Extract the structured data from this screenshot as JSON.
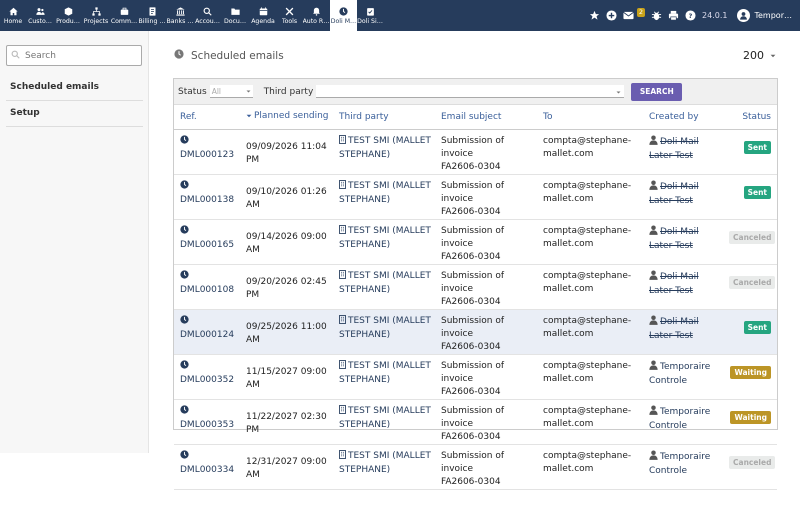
{
  "menu": [
    {
      "label": "Home",
      "icon": "home-icon"
    },
    {
      "label": "Custo…",
      "icon": "users-icon"
    },
    {
      "label": "Produ…",
      "icon": "cube-icon"
    },
    {
      "label": "Projects",
      "icon": "sitemap-icon"
    },
    {
      "label": "Comm…",
      "icon": "suitcase-icon"
    },
    {
      "label": "Billing …",
      "icon": "invoice-icon"
    },
    {
      "label": "Banks …",
      "icon": "bank-icon"
    },
    {
      "label": "Accou…",
      "icon": "search-dollar-icon"
    },
    {
      "label": "Docu…",
      "icon": "folder-icon"
    },
    {
      "label": "Agenda",
      "icon": "calendar-icon"
    },
    {
      "label": "Tools",
      "icon": "tools-icon"
    },
    {
      "label": "Auto R…",
      "icon": "bell-icon"
    },
    {
      "label": "Doli M…",
      "icon": "clock-icon",
      "active": true
    },
    {
      "label": "Doli Si…",
      "icon": "clipboard-icon"
    }
  ],
  "topright": {
    "notification_count": "2",
    "version": "24.0.1",
    "user": "Tempor…"
  },
  "sidebar": {
    "search_placeholder": "Search",
    "links": [
      "Scheduled emails",
      "Setup"
    ]
  },
  "page": {
    "title": "Scheduled emails",
    "limit": "200"
  },
  "filters": {
    "status_label": "Status",
    "status_value": "All",
    "thirdparty_label": "Third party",
    "search_button": "SEARCH"
  },
  "table": {
    "headers": [
      "Ref.",
      "Planned sending",
      "Third party",
      "Email subject",
      "To",
      "Created by",
      "Status"
    ],
    "rows": [
      {
        "ref": "DML000123",
        "date": "09/09/2026 11:04 PM",
        "tp1": "TEST SMI (MALLET",
        "tp2": "STEPHANE)",
        "sub1": "Submission of invoice",
        "sub2": "FA2606-0304",
        "to1": "compta@stephane-",
        "to2": "mallet.com",
        "cb1": "Doli Mail",
        "cb2": "Later Test",
        "struck": true,
        "status": "Sent",
        "st": "sent"
      },
      {
        "ref": "DML000138",
        "date": "09/10/2026 01:26 AM",
        "tp1": "TEST SMI (MALLET",
        "tp2": "STEPHANE)",
        "sub1": "Submission of invoice",
        "sub2": "FA2606-0304",
        "to1": "compta@stephane-",
        "to2": "mallet.com",
        "cb1": "Doli Mail",
        "cb2": "Later Test",
        "struck": true,
        "status": "Sent",
        "st": "sent"
      },
      {
        "ref": "DML000165",
        "date": "09/14/2026 09:00 AM",
        "tp1": "TEST SMI (MALLET",
        "tp2": "STEPHANE)",
        "sub1": "Submission of invoice",
        "sub2": "FA2606-0304",
        "to1": "compta@stephane-",
        "to2": "mallet.com",
        "cb1": "Doli Mail",
        "cb2": "Later Test",
        "struck": true,
        "status": "Canceled",
        "st": "canceled"
      },
      {
        "ref": "DML000108",
        "date": "09/20/2026 02:45 PM",
        "tp1": "TEST SMI (MALLET",
        "tp2": "STEPHANE)",
        "sub1": "Submission of invoice",
        "sub2": "FA2606-0304",
        "to1": "compta@stephane-",
        "to2": "mallet.com",
        "cb1": "Doli Mail",
        "cb2": "Later Test",
        "struck": true,
        "status": "Canceled",
        "st": "canceled"
      },
      {
        "ref": "DML000124",
        "date": "09/25/2026 11:00 AM",
        "tp1": "TEST SMI (MALLET",
        "tp2": "STEPHANE)",
        "sub1": "Submission of invoice",
        "sub2": "FA2606-0304",
        "to1": "compta@stephane-",
        "to2": "mallet.com",
        "cb1": "Doli Mail",
        "cb2": "Later Test",
        "struck": true,
        "status": "Sent",
        "st": "sent",
        "highlight": true
      },
      {
        "ref": "DML000352",
        "date": "11/15/2027 09:00 AM",
        "tp1": "TEST SMI (MALLET",
        "tp2": "STEPHANE)",
        "sub1": "Submission of invoice",
        "sub2": "FA2606-0304",
        "to1": "compta@stephane-",
        "to2": "mallet.com",
        "cb1": "Temporaire",
        "cb2": "Controle",
        "struck": false,
        "status": "Waiting",
        "st": "waiting"
      },
      {
        "ref": "DML000353",
        "date": "11/22/2027 02:30 PM",
        "tp1": "TEST SMI (MALLET",
        "tp2": "STEPHANE)",
        "sub1": "Submission of invoice",
        "sub2": "FA2606-0304",
        "to1": "compta@stephane-",
        "to2": "mallet.com",
        "cb1": "Temporaire",
        "cb2": "Controle",
        "struck": false,
        "status": "Waiting",
        "st": "waiting"
      },
      {
        "ref": "DML000334",
        "date": "12/31/2027 09:00 AM",
        "tp1": "TEST SMI (MALLET",
        "tp2": "STEPHANE)",
        "sub1": "Submission of invoice",
        "sub2": "FA2606-0304",
        "to1": "compta@stephane-",
        "to2": "mallet.com",
        "cb1": "Temporaire",
        "cb2": "Controle",
        "struck": false,
        "status": "Canceled",
        "st": "canceled"
      }
    ]
  }
}
